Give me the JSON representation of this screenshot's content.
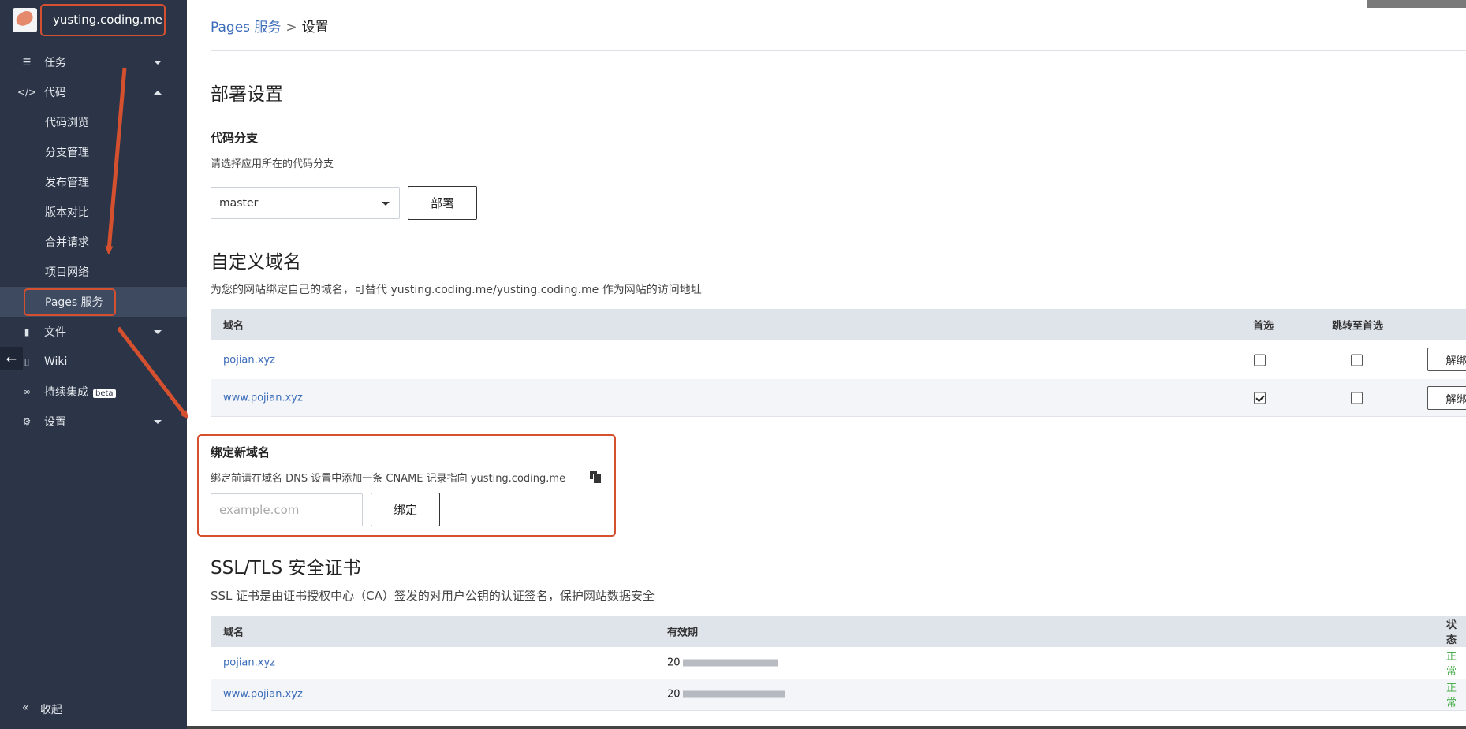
{
  "project": {
    "name": "yusting.coding.me"
  },
  "sidebar": {
    "items": [
      {
        "icon": "list-icon",
        "label": "任务",
        "caret": "down"
      },
      {
        "icon": "code-icon",
        "label": "代码",
        "caret": "up"
      },
      {
        "label": "代码浏览"
      },
      {
        "label": "分支管理"
      },
      {
        "label": "发布管理"
      },
      {
        "label": "版本对比"
      },
      {
        "label": "合并请求"
      },
      {
        "label": "项目网络"
      },
      {
        "label": "Pages 服务",
        "active": true
      },
      {
        "icon": "file-icon",
        "label": "文件",
        "caret": "down"
      },
      {
        "icon": "book-icon",
        "label": "Wiki"
      },
      {
        "icon": "infinity-icon",
        "label": "持续集成",
        "badge": "beta"
      },
      {
        "icon": "gear-icon",
        "label": "设置",
        "caret": "down"
      }
    ],
    "collapse_label": "收起"
  },
  "breadcrumb": {
    "parent": "Pages 服务",
    "separator": ">",
    "current": "设置"
  },
  "deploy": {
    "title": "部署设置",
    "branch_heading": "代码分支",
    "branch_desc": "请选择应用所在的代码分支",
    "branch_value": "master",
    "deploy_button": "部署"
  },
  "custom_domain": {
    "title": "自定义域名",
    "desc": "为您的网站绑定自己的域名，可替代 yusting.coding.me/yusting.coding.me 作为网站的访问地址",
    "columns": [
      "域名",
      "首选",
      "跳转至首选"
    ],
    "rows": [
      {
        "domain": "pojian.xyz",
        "preferred": false,
        "redirect": false,
        "action": "解绑"
      },
      {
        "domain": "www.pojian.xyz",
        "preferred": true,
        "redirect": false,
        "action": "解绑"
      }
    ]
  },
  "bind": {
    "title": "绑定新域名",
    "desc": "绑定前请在域名 DNS 设置中添加一条 CNAME 记录指向 yusting.coding.me",
    "placeholder": "example.com",
    "button": "绑定"
  },
  "ssl": {
    "title": "SSL/TLS 安全证书",
    "desc": "SSL 证书是由证书授权中心（CA）签发的对用户公钥的认证签名，保护网站数据安全",
    "columns": [
      "域名",
      "有效期",
      "状态"
    ],
    "rows": [
      {
        "domain": "pojian.xyz",
        "validity": "20",
        "status": "正常"
      },
      {
        "domain": "www.pojian.xyz",
        "validity": "20",
        "status": "正常"
      }
    ]
  },
  "colors": {
    "sidebar_bg": "#2b3547",
    "link": "#3b6cba",
    "highlight": "#d5502f",
    "ok": "#4caf50"
  }
}
